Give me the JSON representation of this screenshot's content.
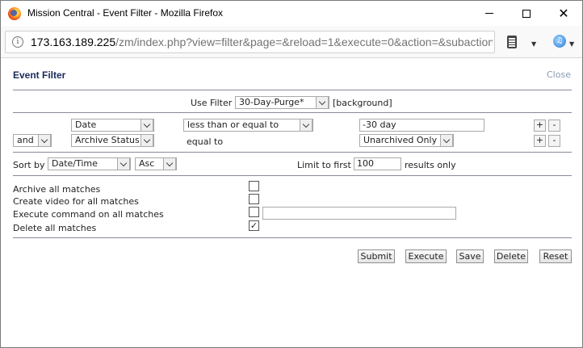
{
  "window": {
    "title": "Mission Central - Event Filter - Mozilla Firefox",
    "url_host": "173.163.189.225",
    "url_path": "/zm/index.php?view=filter&page=&reload=1&execute=0&action=&subaction"
  },
  "header": {
    "title": "Event Filter",
    "close_label": "Close"
  },
  "use_filter": {
    "label": "Use Filter",
    "selected": "30-Day-Purge*",
    "tag": "[background]"
  },
  "terms": [
    {
      "conjunction": "",
      "attribute": "Date",
      "operator": "less than or equal to",
      "value": "-30 day"
    },
    {
      "conjunction": "and",
      "attribute": "Archive Status",
      "operator": "equal to",
      "value": "Unarchived Only"
    }
  ],
  "add_label": "+",
  "remove_label": "-",
  "sort": {
    "label": "Sort by",
    "field": "Date/Time",
    "direction": "Asc"
  },
  "limit": {
    "label": "Limit to first",
    "value": "100",
    "suffix": "results only"
  },
  "actions": [
    {
      "label": "Archive all matches",
      "checked": false
    },
    {
      "label": "Create video for all matches",
      "checked": false
    },
    {
      "label": "Execute command on all matches",
      "checked": false,
      "command_value": ""
    },
    {
      "label": "Delete all matches",
      "checked": true
    }
  ],
  "check_mark": "✓",
  "buttons": {
    "submit": "Submit",
    "execute": "Execute",
    "save": "Save",
    "delete": "Delete",
    "reset": "Reset"
  },
  "colors": {
    "title": "#1a2a5a",
    "close_link": "#8a9ab0",
    "divider": "#8a8a9a"
  }
}
